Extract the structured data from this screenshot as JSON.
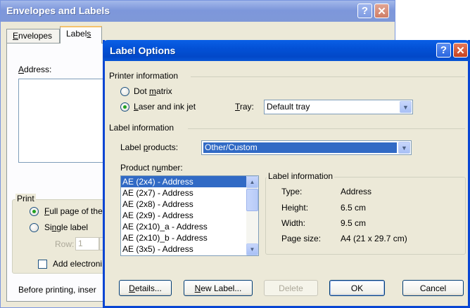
{
  "back_window": {
    "title": "Envelopes and Labels",
    "help_glyph": "?",
    "close_glyph": "✕",
    "tabs": [
      {
        "prefix": "",
        "accel": "E",
        "rest": "nvelopes"
      },
      {
        "prefix": "Label",
        "accel": "s",
        "rest": ""
      }
    ],
    "address_accel": "A",
    "address_rest": "ddress:",
    "print_group": "Print",
    "full_page_accel": "F",
    "full_page_rest": "ull page of the",
    "single_pre": "Si",
    "single_accel": "n",
    "single_rest": "gle label",
    "row_label": "Row:",
    "row_value": "1",
    "add_electronic": "Add electroni",
    "before_printing": "Before printing, inser"
  },
  "dialog": {
    "title": "Label Options",
    "help_glyph": "?",
    "close_glyph": "✕",
    "printer_info_label": "Printer information",
    "dot_pre": "Dot ",
    "dot_accel": "m",
    "dot_rest": "atrix",
    "laser_accel": "L",
    "laser_rest": "aser and ink jet",
    "tray_accel": "T",
    "tray_rest": "ray:",
    "tray_value": "Default tray",
    "label_info_label": "Label information",
    "label_products_pre": "Label ",
    "label_products_accel": "p",
    "label_products_rest": "roducts:",
    "label_products_value": "Other/Custom",
    "product_number_pre": "Product n",
    "product_number_accel": "u",
    "product_number_rest": "mber:",
    "products": [
      "AE (2x4) - Address",
      "AE (2x7) - Address",
      "AE (2x8) - Address",
      "AE (2x9) - Address",
      "AE (2x10)_a - Address",
      "AE (2x10)_b - Address",
      "AE (3x5) - Address"
    ],
    "info_group_label": "Label information",
    "info": {
      "type_label": "Type:",
      "type_value": "Address",
      "height_label": "Height:",
      "height_value": "6.5 cm",
      "width_label": "Width:",
      "width_value": "9.5 cm",
      "page_size_label": "Page size:",
      "page_size_value": "A4 (21 x 29.7 cm)"
    },
    "buttons": {
      "details_accel": "D",
      "details_rest": "etails...",
      "new_label_accel": "N",
      "new_label_rest": "ew Label...",
      "delete": "Delete",
      "ok": "OK",
      "cancel": "Cancel"
    },
    "arrow_down": "▼",
    "arrow_up": "▲"
  }
}
